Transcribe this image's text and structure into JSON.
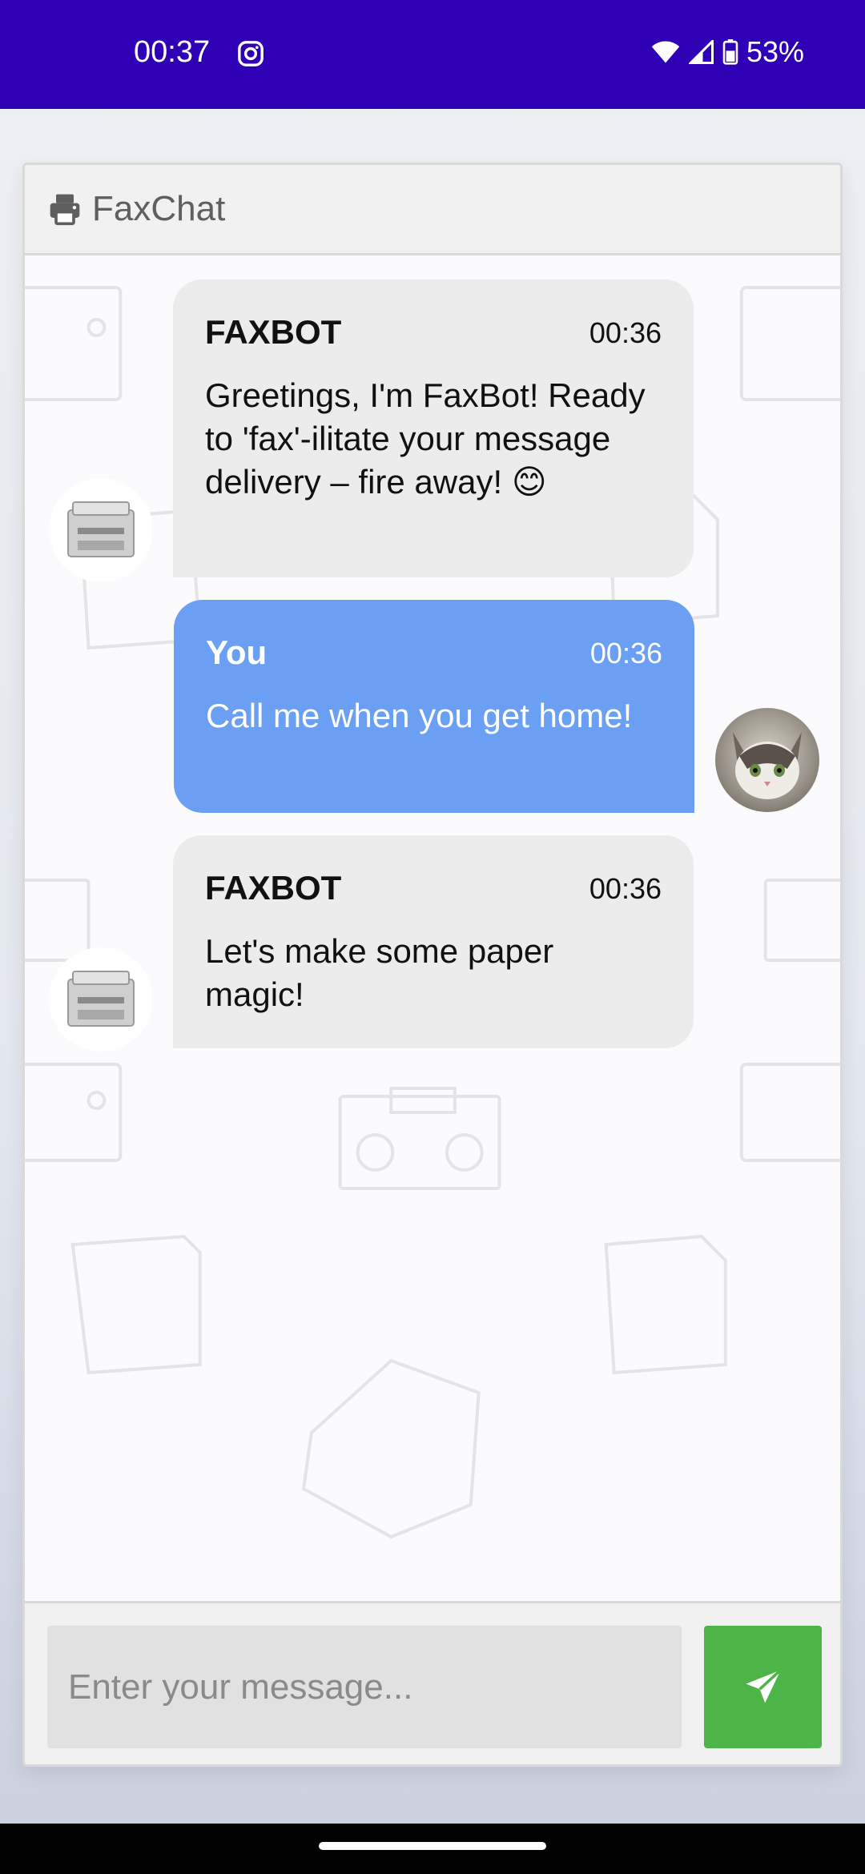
{
  "status_bar": {
    "time": "00:37",
    "battery": "53%"
  },
  "app": {
    "title": "FaxChat"
  },
  "messages": [
    {
      "sender": "FAXBOT",
      "time": "00:36",
      "text": "Greetings, I'm FaxBot! Ready to 'fax'-ilitate your message delivery – fire away! 😊",
      "role": "bot"
    },
    {
      "sender": "You",
      "time": "00:36",
      "text": "Call me when you get home!",
      "role": "user"
    },
    {
      "sender": "FAXBOT",
      "time": "00:36",
      "text": "Let's make some paper magic!",
      "role": "bot"
    }
  ],
  "input": {
    "placeholder": "Enter your message..."
  },
  "colors": {
    "status_bar": "#2f00b5",
    "user_bubble": "#6a9ff3",
    "bot_bubble": "#ececec",
    "send_button": "#4db547"
  }
}
